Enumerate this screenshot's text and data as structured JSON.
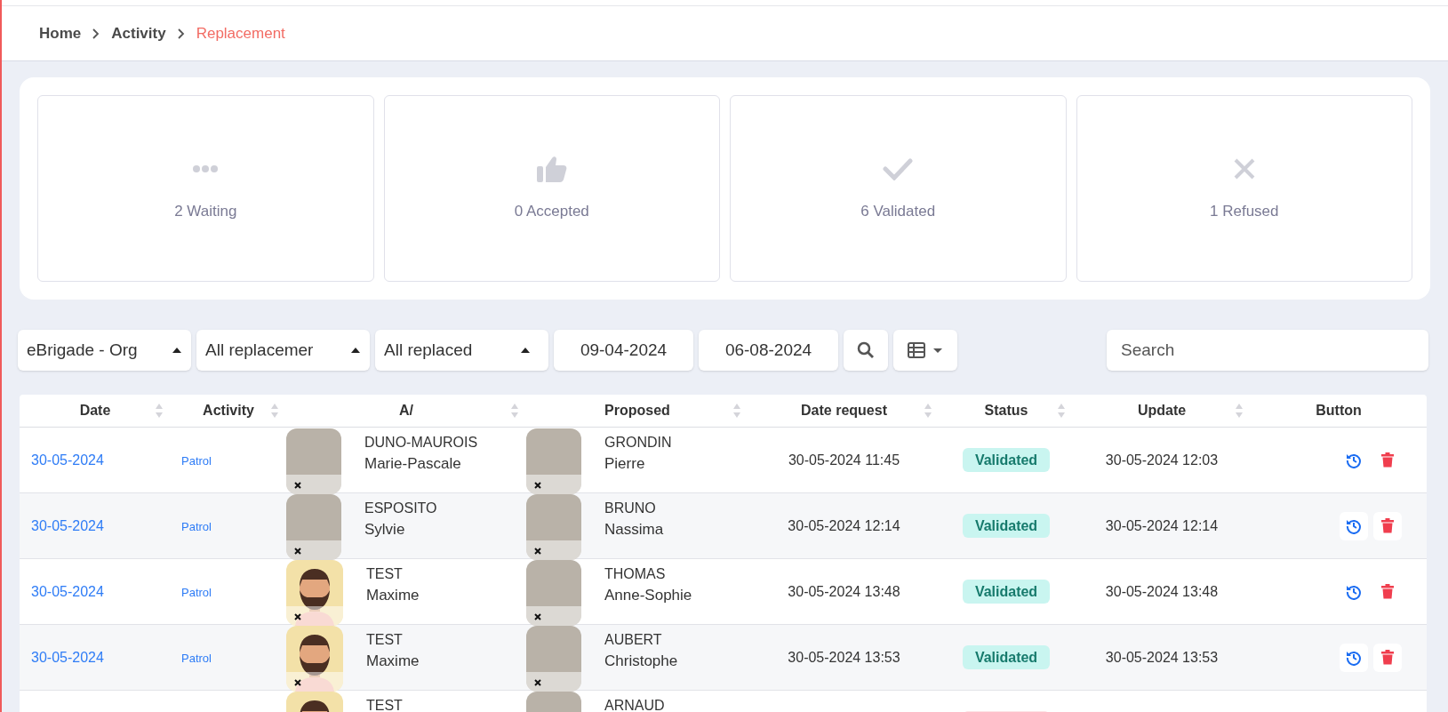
{
  "breadcrumb": [
    {
      "label": "Home",
      "current": false
    },
    {
      "label": "Activity",
      "current": false
    },
    {
      "label": "Replacement",
      "current": true
    }
  ],
  "summary_cards": [
    {
      "kind": "waiting",
      "label": "2 Waiting"
    },
    {
      "kind": "accepted",
      "label": "0 Accepted"
    },
    {
      "kind": "validated",
      "label": "6 Validated"
    },
    {
      "kind": "refused",
      "label": "1 Refused"
    }
  ],
  "filters": {
    "organization": "eBrigade - Org",
    "replacements": "All replacemer",
    "replaced": "All replaced",
    "date_from": "09-04-2024",
    "date_to": "06-08-2024",
    "search_placeholder": "Search"
  },
  "table": {
    "columns": [
      {
        "label": "Date",
        "sortable": true
      },
      {
        "label": "Activity",
        "sortable": true
      },
      {
        "label": "A/",
        "sortable": true
      },
      {
        "label": "Proposed",
        "sortable": true
      },
      {
        "label": "Date request",
        "sortable": true
      },
      {
        "label": "Status",
        "sortable": true
      },
      {
        "label": "Update",
        "sortable": true
      },
      {
        "label": "Button",
        "sortable": false
      }
    ],
    "rows": [
      {
        "date": "30-05-2024",
        "activity": "Patrol",
        "absent": {
          "last_name": "DUNO-MAUROIS",
          "first_name": "Marie-Pascale",
          "avatar": {
            "kind": "photo"
          }
        },
        "proposed": {
          "last_name": "GRONDIN",
          "first_name": "Pierre",
          "avatar": {
            "kind": "photo"
          }
        },
        "date_request": "30-05-2024 11:45",
        "status": {
          "kind": "validated",
          "label": "Validated"
        },
        "update": "30-05-2024 12:03"
      },
      {
        "date": "30-05-2024",
        "activity": "Patrol",
        "absent": {
          "last_name": "ESPOSITO",
          "first_name": "Sylvie",
          "avatar": {
            "kind": "photo"
          }
        },
        "proposed": {
          "last_name": "BRUNO",
          "first_name": "Nassima",
          "avatar": {
            "kind": "photo"
          }
        },
        "date_request": "30-05-2024 12:14",
        "status": {
          "kind": "validated",
          "label": "Validated"
        },
        "update": "30-05-2024 12:14"
      },
      {
        "date": "30-05-2024",
        "activity": "Patrol",
        "absent": {
          "last_name": "TEST",
          "first_name": "Maxime",
          "avatar": {
            "kind": "cartoon"
          }
        },
        "proposed": {
          "last_name": "THOMAS",
          "first_name": "Anne-Sophie",
          "avatar": {
            "kind": "photo"
          }
        },
        "date_request": "30-05-2024 13:48",
        "status": {
          "kind": "validated",
          "label": "Validated"
        },
        "update": "30-05-2024 13:48"
      },
      {
        "date": "30-05-2024",
        "activity": "Patrol",
        "absent": {
          "last_name": "TEST",
          "first_name": "Maxime",
          "avatar": {
            "kind": "cartoon"
          }
        },
        "proposed": {
          "last_name": "AUBERT",
          "first_name": "Christophe",
          "avatar": {
            "kind": "photo"
          }
        },
        "date_request": "30-05-2024 13:53",
        "status": {
          "kind": "validated",
          "label": "Validated"
        },
        "update": "30-05-2024 13:53"
      },
      {
        "absent": {
          "last_name": "TEST",
          "avatar": {
            "kind": "cartoon"
          }
        },
        "proposed": {
          "last_name": "ARNAUD",
          "avatar": {
            "kind": "photo"
          }
        },
        "status": {
          "kind": "refused"
        }
      }
    ]
  }
}
